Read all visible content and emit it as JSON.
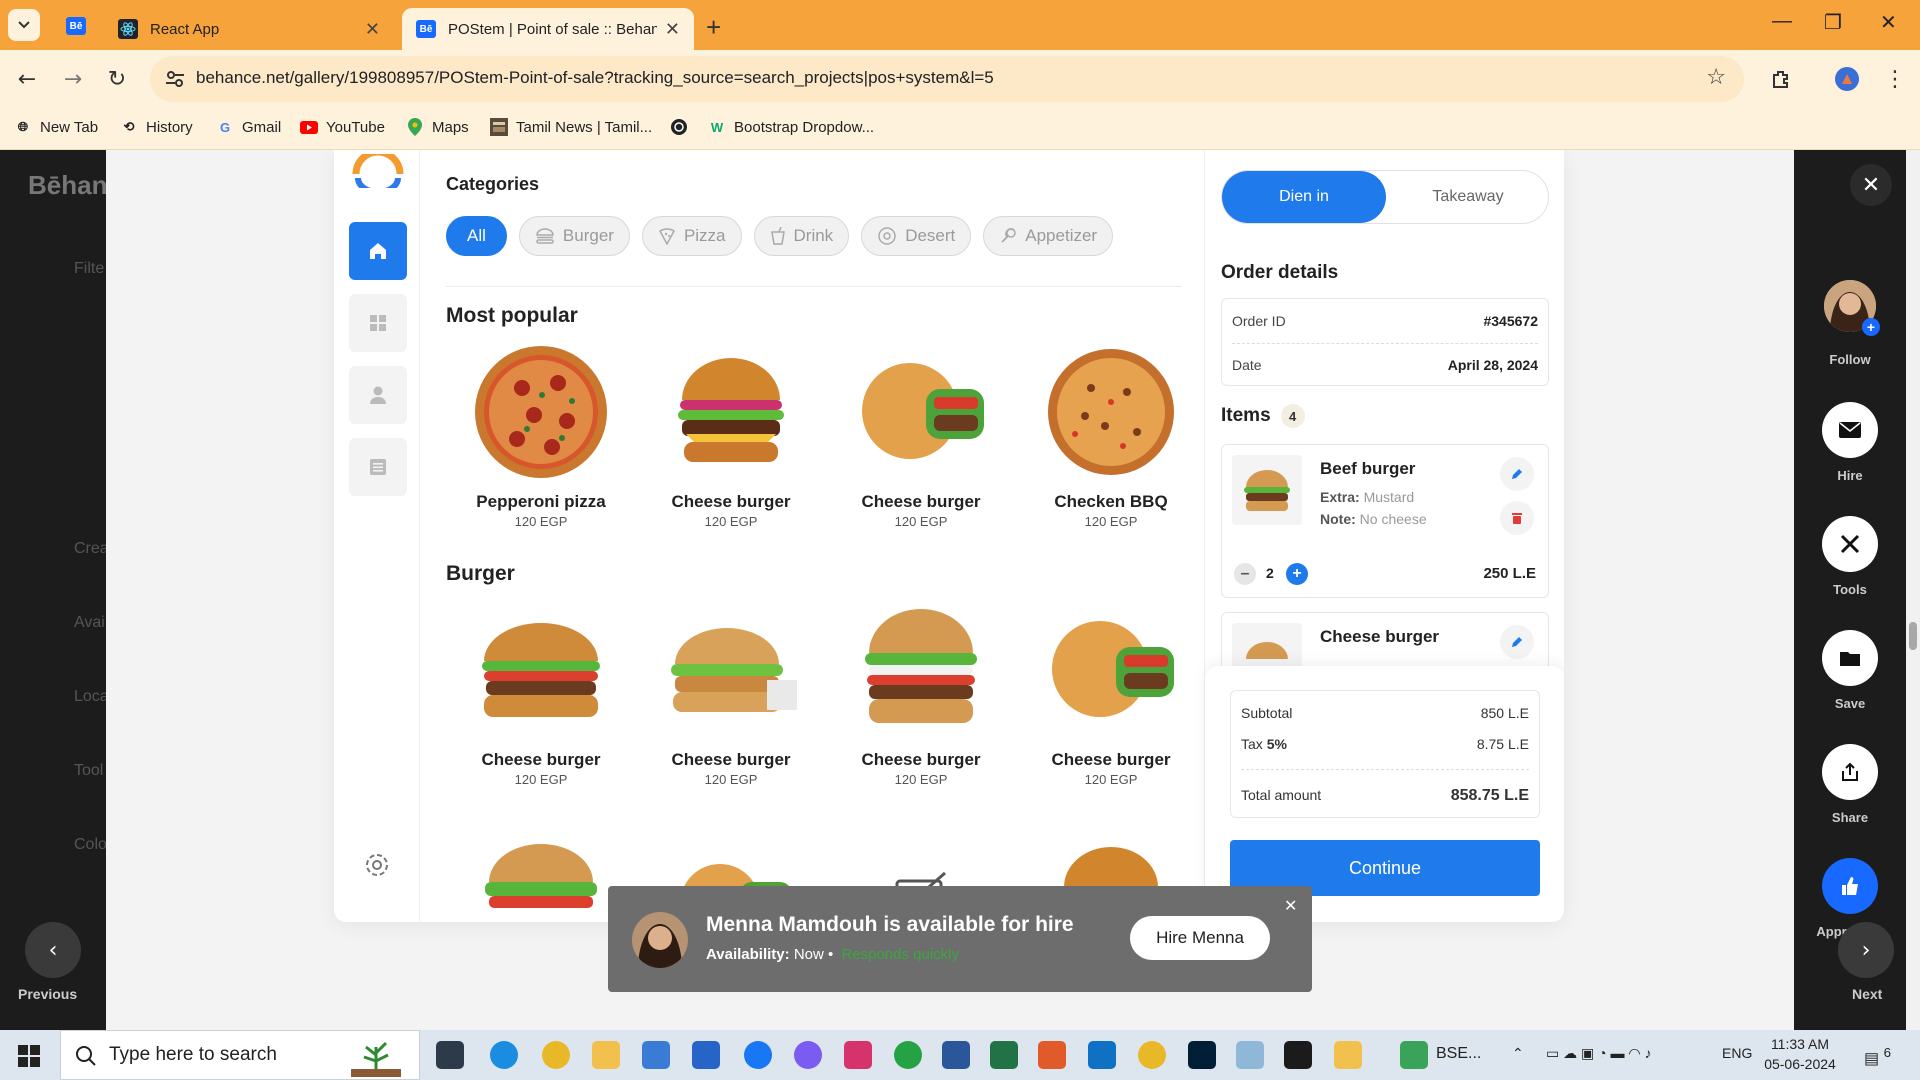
{
  "browser": {
    "tabs": [
      {
        "label": "React App"
      },
      {
        "label": "POStem | Point of sale :: Behanc"
      }
    ],
    "url": "behance.net/gallery/199808957/POStem-Point-of-sale?tracking_source=search_projects|pos+system&l=5",
    "bookmarks": [
      "New Tab",
      "History",
      "Gmail",
      "YouTube",
      "Maps",
      "Tamil News | Tamil...",
      "Bootstrap Dropdow..."
    ],
    "pinned_tab_icon": "Bē"
  },
  "behance": {
    "logo": "Bēhan",
    "left_ghost": [
      "Filte",
      "Crea",
      "Avai",
      "Loca",
      "Tool",
      "Colo"
    ],
    "prev_label": "Previous",
    "next_label": "Next",
    "rail": {
      "follow": "Follow",
      "hire": "Hire",
      "tools": "Tools",
      "save": "Save",
      "share": "Share",
      "appreciate": "Appreciate"
    }
  },
  "pos": {
    "categories_title": "Categories",
    "categories": [
      {
        "label": "All",
        "active": true
      },
      {
        "label": "Burger"
      },
      {
        "label": "Pizza"
      },
      {
        "label": "Drink"
      },
      {
        "label": "Desert"
      },
      {
        "label": "Appetizer"
      }
    ],
    "most_popular_title": "Most popular",
    "most_popular": [
      {
        "name": "Pepperoni pizza",
        "price": "120 EGP"
      },
      {
        "name": "Cheese burger",
        "price": "120 EGP"
      },
      {
        "name": "Cheese burger",
        "price": "120 EGP"
      },
      {
        "name": "Checken BBQ",
        "price": "120 EGP"
      }
    ],
    "burger_title": "Burger",
    "burgers": [
      {
        "name": "Cheese burger",
        "price": "120 EGP"
      },
      {
        "name": "Cheese burger",
        "price": "120 EGP"
      },
      {
        "name": "Cheese burger",
        "price": "120 EGP"
      },
      {
        "name": "Cheese burger",
        "price": "120 EGP"
      }
    ],
    "order": {
      "dine_in": "Dien in",
      "takeaway": "Takeaway",
      "title": "Order details",
      "id_label": "Order ID",
      "id_value": "#345672",
      "date_label": "Date",
      "date_value": "April 28, 2024",
      "items_label": "Items",
      "items_count": "4",
      "items": [
        {
          "name": "Beef burger",
          "extra_label": "Extra:",
          "extra": "Mustard",
          "note_label": "Note:",
          "note": "No cheese",
          "qty": "2",
          "total": "250 L.E"
        },
        {
          "name": "Cheese burger"
        }
      ],
      "subtotal_label": "Subtotal",
      "subtotal": "850 L.E",
      "tax_label": "Tax",
      "tax_rate": "5%",
      "tax": "8.75 L.E",
      "total_label": "Total amount",
      "total": "858.75 L.E",
      "continue": "Continue"
    }
  },
  "toast": {
    "title": "Menna Mamdouh is available for hire",
    "availability_label": "Availability:",
    "availability": "Now",
    "responds": "Responds quickly",
    "button": "Hire Menna"
  },
  "taskbar": {
    "search_placeholder": "Type here to search",
    "pinned_label": "BSE...",
    "lang": "ENG",
    "time": "11:33 AM",
    "date": "05-06-2024",
    "notifications": "6"
  },
  "colors": {
    "accent": "#1f7aec",
    "chrome": "#f5a33a"
  }
}
